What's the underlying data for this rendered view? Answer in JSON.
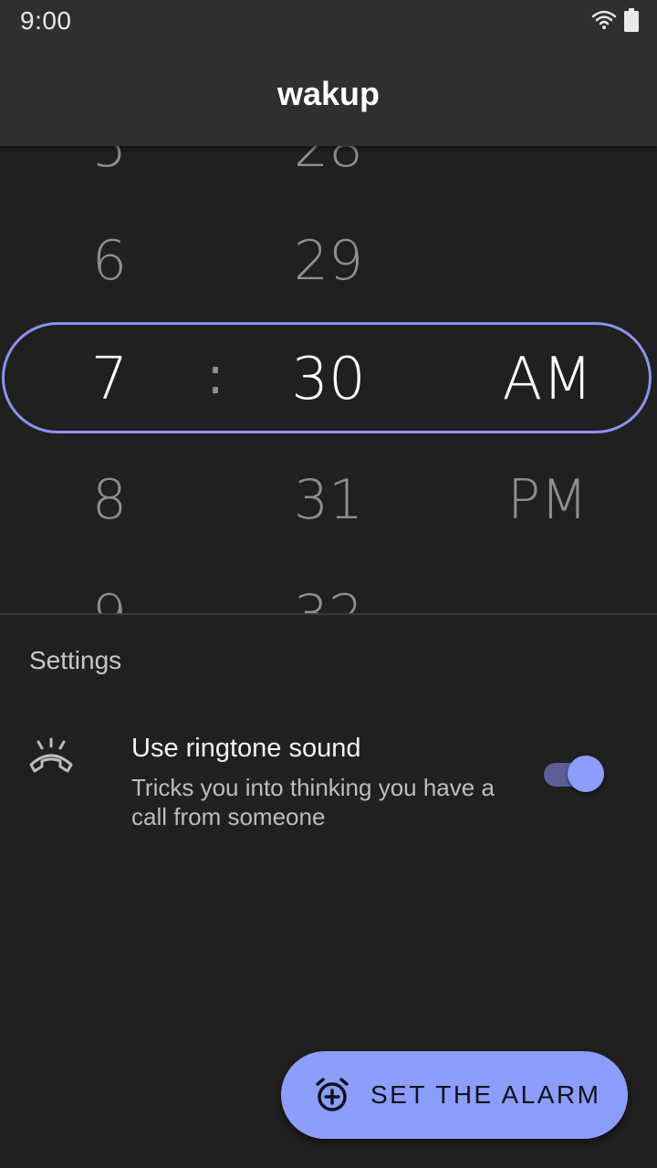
{
  "status_bar": {
    "time": "9:00",
    "icons": [
      "wifi-icon",
      "battery-icon"
    ]
  },
  "app_bar": {
    "title": "wakup"
  },
  "time_picker": {
    "hours": [
      "5",
      "6",
      "7",
      "8",
      "9"
    ],
    "minutes": [
      "28",
      "29",
      "30",
      "31",
      "32"
    ],
    "periods": [
      "AM",
      "PM"
    ],
    "selected_hour": "7",
    "selected_minute": "30",
    "selected_period": "AM",
    "separator": ":"
  },
  "settings": {
    "header": "Settings",
    "items": [
      {
        "icon": "ringtone-icon",
        "title": "Use ringtone sound",
        "description": "Tricks you into thinking you have a call from someone",
        "enabled": true
      }
    ]
  },
  "fab": {
    "icon": "add-alarm-icon",
    "label": "SET THE ALARM"
  },
  "colors": {
    "accent": "#8c9dfb",
    "frame": "#8a93ee",
    "background": "#202020",
    "app_bar": "#2f2f2f"
  }
}
